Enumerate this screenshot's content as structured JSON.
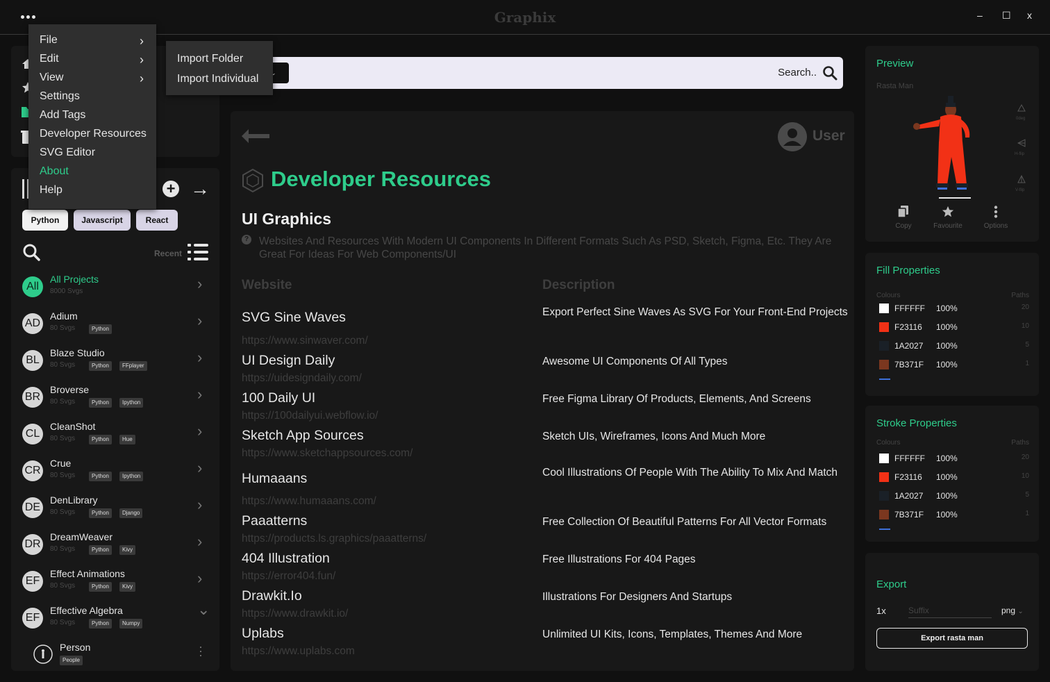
{
  "app": {
    "title": "Graphix",
    "minimize": "–",
    "maximize": "☐",
    "close": "x"
  },
  "menu": {
    "items": [
      {
        "label": "File",
        "submenu": true
      },
      {
        "label": "Edit",
        "submenu": true
      },
      {
        "label": "View",
        "submenu": true
      },
      {
        "label": "Settings",
        "submenu": false
      },
      {
        "label": "Add Tags",
        "submenu": false
      },
      {
        "label": "Developer Resources",
        "submenu": false
      },
      {
        "label": "SVG Editor",
        "submenu": false
      },
      {
        "label": "About",
        "submenu": false,
        "active": true
      },
      {
        "label": "Help",
        "submenu": false
      }
    ],
    "submenu_items": [
      "Import Folder",
      "Import Individual"
    ],
    "active_color": "#2ecc8b"
  },
  "sidebar": {
    "chips": [
      "Python",
      "Javascript",
      "React"
    ],
    "recent_label": "Recent",
    "projects": [
      {
        "avatar": "All",
        "name": "All Projects",
        "count": "8000 Svgs",
        "tags": [],
        "active": true
      },
      {
        "avatar": "AD",
        "name": "Adium",
        "count": "80 Svgs",
        "tags": [
          "Python"
        ]
      },
      {
        "avatar": "BL",
        "name": "Blaze Studio",
        "count": "80 Svgs",
        "tags": [
          "Python",
          "FFplayer"
        ]
      },
      {
        "avatar": "BR",
        "name": "Broverse",
        "count": "80 Svgs",
        "tags": [
          "Python",
          "Ipython"
        ]
      },
      {
        "avatar": "CL",
        "name": "CleanShot",
        "count": "80 Svgs",
        "tags": [
          "Python",
          "Hue"
        ]
      },
      {
        "avatar": "CR",
        "name": "Crue",
        "count": "80 Svgs",
        "tags": [
          "Python",
          "Ipython"
        ]
      },
      {
        "avatar": "DE",
        "name": "DenLibrary",
        "count": "80 Svgs",
        "tags": [
          "Python",
          "Django"
        ]
      },
      {
        "avatar": "DR",
        "name": "DreamWeaver",
        "count": "80 Svgs",
        "tags": [
          "Python",
          "Kivy"
        ]
      },
      {
        "avatar": "EF",
        "name": "Effect Animations",
        "count": "80 Svgs",
        "tags": [
          "Python",
          "Kivy"
        ]
      },
      {
        "avatar": "EF",
        "name": "Effective Algebra",
        "count": "80 Svgs",
        "tags": [
          "Python",
          "Numpy"
        ],
        "expanded": true
      }
    ],
    "sub_item": {
      "name": "Person",
      "tag": "People"
    }
  },
  "search": {
    "placeholder": "Search.."
  },
  "main": {
    "user_label": "User",
    "page_title": "Developer Resources",
    "section_title": "UI Graphics",
    "section_desc": "Websites And Resources With Modern UI Components In Different Formats Such As PSD, Sketch, Figma, Etc. They Are Great For Ideas For Web Components/UI",
    "col_website": "Website",
    "col_description": "Description",
    "resources": [
      {
        "name": "SVG Sine Waves",
        "url": "https://www.sinwaver.com/",
        "desc": "Export Perfect Sine Waves As SVG For Your Front-End Projects"
      },
      {
        "name": "UI Design Daily",
        "url": "https://uidesigndaily.com/",
        "desc": "Awesome UI Components Of All Types"
      },
      {
        "name": "100 Daily UI",
        "url": "https://100dailyui.webflow.io/",
        "desc": "Free Figma Library Of Products, Elements, And Screens"
      },
      {
        "name": "Sketch App Sources",
        "url": "https://www.sketchappsources.com/",
        "desc": "Sketch UIs, Wireframes, Icons And Much More"
      },
      {
        "name": "Humaaans",
        "url": "https://www.humaaans.com/",
        "desc": "Cool Illustrations Of People With The Ability To Mix And Match"
      },
      {
        "name": "Paaatterns",
        "url": "https://products.ls.graphics/paaatterns/",
        "desc": "Free Collection Of Beautiful Patterns For All Vector Formats"
      },
      {
        "name": "404 Illustration",
        "url": "https://error404.fun/",
        "desc": "Free Illustrations For 404  Pages"
      },
      {
        "name": "Drawkit.Io",
        "url": "https://www.drawkit.io/",
        "desc": "Illustrations For Designers And Startups"
      },
      {
        "name": " Uplabs",
        "url": "https://www.uplabs.com",
        "desc": "Unlimited UI Kits, Icons, Templates, Themes And More"
      }
    ]
  },
  "preview": {
    "title": "Preview",
    "subtitle": "Rasta Man",
    "tools": [
      "0deg",
      "H-flip",
      "V-flip"
    ],
    "actions": [
      {
        "label": "Copy",
        "icon": "copy-icon"
      },
      {
        "label": "Favourite",
        "icon": "star-icon"
      },
      {
        "label": "Options",
        "icon": "kebab-icon"
      }
    ]
  },
  "fill": {
    "title": "Fill Properties",
    "colours_label": "Colours",
    "paths_label": "Paths",
    "rows": [
      {
        "hex": "FFFFFF",
        "pct": "100%",
        "paths": "20",
        "color": "#FFFFFF"
      },
      {
        "hex": "F23116",
        "pct": "100%",
        "paths": "10",
        "color": "#F23116"
      },
      {
        "hex": "1A2027",
        "pct": "100%",
        "paths": "5",
        "color": "#1A2027"
      },
      {
        "hex": "7B371F",
        "pct": "100%",
        "paths": "1",
        "color": "#7B371F"
      }
    ]
  },
  "stroke": {
    "title": "Stroke Properties",
    "colours_label": "Colours",
    "paths_label": "Paths",
    "rows": [
      {
        "hex": "FFFFFF",
        "pct": "100%",
        "paths": "20",
        "color": "#FFFFFF"
      },
      {
        "hex": "F23116",
        "pct": "100%",
        "paths": "10",
        "color": "#F23116"
      },
      {
        "hex": "1A2027",
        "pct": "100%",
        "paths": "5",
        "color": "#1A2027"
      },
      {
        "hex": "7B371F",
        "pct": "100%",
        "paths": "1",
        "color": "#7B371F"
      }
    ]
  },
  "export": {
    "title": "Export",
    "scale": "1x",
    "suffix_placeholder": "Suffix",
    "format": "png",
    "button_label": "Export rasta man"
  }
}
